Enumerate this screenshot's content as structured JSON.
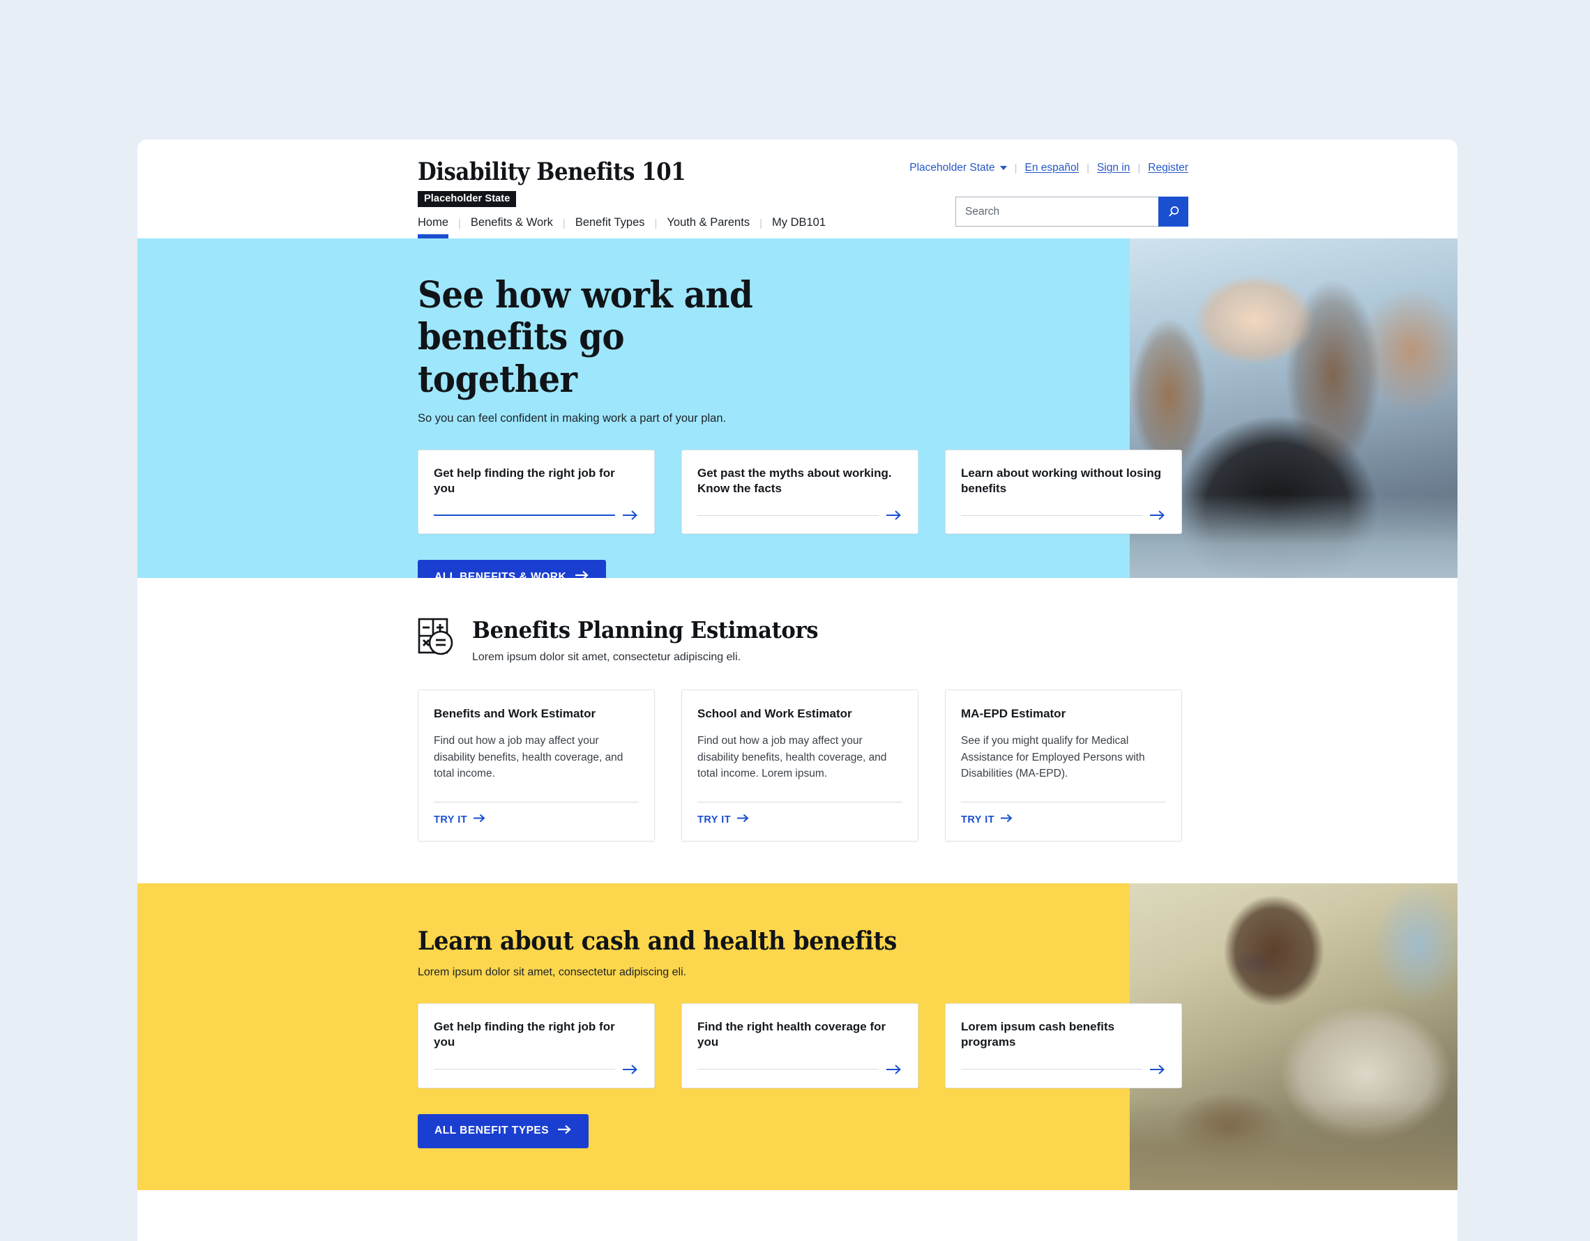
{
  "header": {
    "brand_title": "Disability Benefits 101",
    "brand_badge": "Placeholder State",
    "state_selector": "Placeholder State",
    "links": [
      {
        "label": "En español"
      },
      {
        "label": "Sign in"
      },
      {
        "label": "Register"
      }
    ],
    "separator": "|",
    "search": {
      "placeholder": "Search",
      "value": "",
      "icon": "search-icon"
    },
    "nav": [
      {
        "label": "Home",
        "active": true
      },
      {
        "label": "Benefits & Work",
        "active": false
      },
      {
        "label": "Benefit Types",
        "active": false
      },
      {
        "label": "Youth & Parents",
        "active": false
      },
      {
        "label": "My DB101",
        "active": false
      }
    ]
  },
  "hero": {
    "title": "See how work and benefits go together",
    "subtitle": "So you can feel confident in making work a part of your plan.",
    "cards": [
      {
        "title": "Get help finding the right job for you",
        "rule_active": true
      },
      {
        "title": "Get past the myths about working. Know the facts",
        "rule_active": false
      },
      {
        "title": "Learn about working without losing benefits",
        "rule_active": false
      }
    ],
    "cta_label": "ALL BENEFITS & WORK",
    "background_color": "#9ee6fb"
  },
  "estimators": {
    "icon": "calculator-icon",
    "title": "Benefits Planning Estimators",
    "subtitle": "Lorem ipsum dolor sit amet, consectetur adipiscing eli.",
    "cards": [
      {
        "title": "Benefits and Work Estimator",
        "body": "Find out how a job may affect your disability benefits, health coverage, and total income.",
        "link_label": "TRY IT"
      },
      {
        "title": "School and Work Estimator",
        "body": "Find out how a job may affect your disability benefits, health coverage, and total income. Lorem ipsum.",
        "link_label": "TRY IT"
      },
      {
        "title": "MA-EPD Estimator",
        "body": "See if you might qualify for Medical Assistance for Employed Persons with Disabilities (MA-EPD).",
        "link_label": "TRY IT"
      }
    ]
  },
  "benefits_section": {
    "title": "Learn about cash and health benefits",
    "subtitle": "Lorem ipsum dolor sit amet, consectetur adipiscing eli.",
    "cards": [
      {
        "title": "Get help finding the right job for you"
      },
      {
        "title": "Find the right health coverage for you"
      },
      {
        "title": "Lorem ipsum cash benefits programs"
      }
    ],
    "cta_label": "ALL BENEFIT TYPES",
    "background_color": "#fcd64c"
  },
  "colors": {
    "accent_blue": "#1a4fd0",
    "button_blue": "#1a3fd0",
    "hero_cyan": "#9ee6fb",
    "section_yellow": "#fcd64c",
    "page_backdrop": "#e8eef6",
    "text_dark": "#101418"
  }
}
